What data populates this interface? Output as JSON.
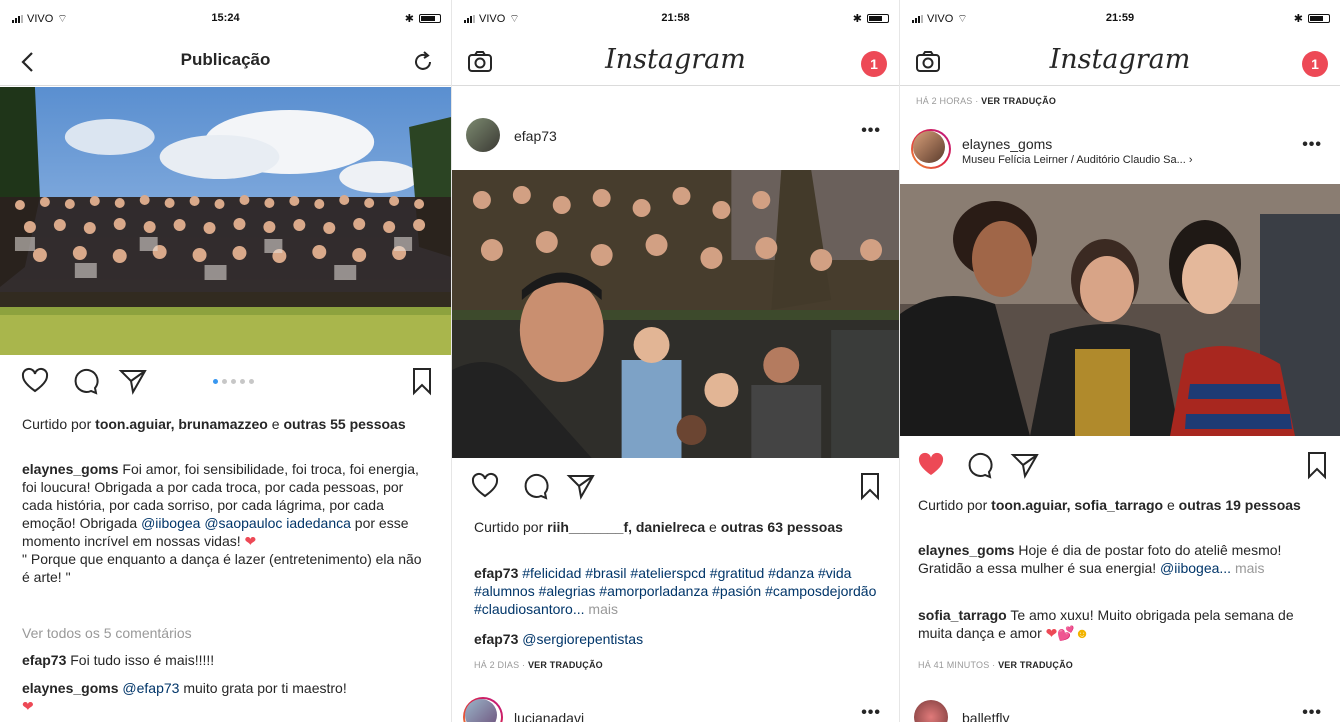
{
  "colors": {
    "accent": "#3897f0",
    "like": "#ed4956",
    "hashtag": "#003569",
    "muted": "#999999"
  },
  "screens": [
    {
      "status": {
        "carrier": "VIVO",
        "time": "15:24"
      },
      "nav": {
        "title": "Publicação",
        "left_icon": "back-chevron-icon",
        "right_icon": "refresh-icon"
      },
      "post": {
        "likes_prefix": "Curtido por ",
        "likers": "toon.aguiar, brunamazzeo",
        "likes_suffix": " e ",
        "likes_count": "outras 55 pessoas",
        "caption_user": "elaynes_goms",
        "caption_text": " Foi amor, foi sensibilidade, foi troca, foi energia, foi loucura! Obrigada a por cada troca, por cada pessoas, por cada história, por cada sorriso, por cada lágrima, por cada emoção! Obrigada ",
        "mention1": "@iibogea",
        "mention2": "@saopauloc iadedanca",
        "caption_text2": " por esse momento incrível em nossas vidas! ",
        "quote": "\" Porque que enquanto a dança é lazer (entretenimento) ela não é arte! \"",
        "view_comments": "Ver todos os 5 comentários",
        "comments": [
          {
            "user": "efap73",
            "text": " Foi tudo isso é mais!!!!!"
          },
          {
            "user": "elaynes_goms",
            "mention": "@efap73",
            "text": " muito grata por ti maestro!"
          }
        ]
      }
    },
    {
      "status": {
        "carrier": "VIVO",
        "time": "21:58"
      },
      "nav": {
        "logo": "Instagram",
        "badge": "1"
      },
      "post": {
        "user": "efap73",
        "likes_prefix": "Curtido por ",
        "likers": "riih_______f, danielreca",
        "likes_suffix": " e ",
        "likes_count": "outras 63 pessoas",
        "caption_user": "efap73",
        "hashtags": "#felicidad #brasil #atelierspcd #gratitud #danza #vida #alumnos #alegrias #amorporladanza #pasión #camposdejordão #claudiosantoro...",
        "more": " mais",
        "comment_user": "efap73",
        "comment_mention": "@sergiorepentistas",
        "time": "HÁ 2 DIAS",
        "translate": "VER TRADUÇÃO",
        "next_user": "lucianadavi"
      }
    },
    {
      "status": {
        "carrier": "VIVO",
        "time": "21:59"
      },
      "nav": {
        "logo": "Instagram",
        "badge": "1"
      },
      "post": {
        "prev_time": "HÁ 2 HORAS",
        "prev_translate": "VER TRADUÇÃO",
        "user": "elaynes_goms",
        "location": "Museu Felícia Leirner / Auditório Claudio Sa... ›",
        "likes_prefix": "Curtido por ",
        "likers": "toon.aguiar, sofia_tarrago",
        "likes_suffix": " e ",
        "likes_count": "outras 19 pessoas",
        "caption_user": "elaynes_goms",
        "caption_text": " Hoje é dia de postar foto do ateliê mesmo! Gratidão a essa mulher é sua energia! ",
        "mention": "@iibogea...",
        "more": " mais",
        "comment_user": "sofia_tarrago",
        "comment_text": " Te amo xuxu! Muito obrigada pela semana de muita dança e amor ",
        "time": "HÁ 41 MINUTOS",
        "translate": "VER TRADUÇÃO",
        "next_user": "balletfly"
      }
    }
  ]
}
